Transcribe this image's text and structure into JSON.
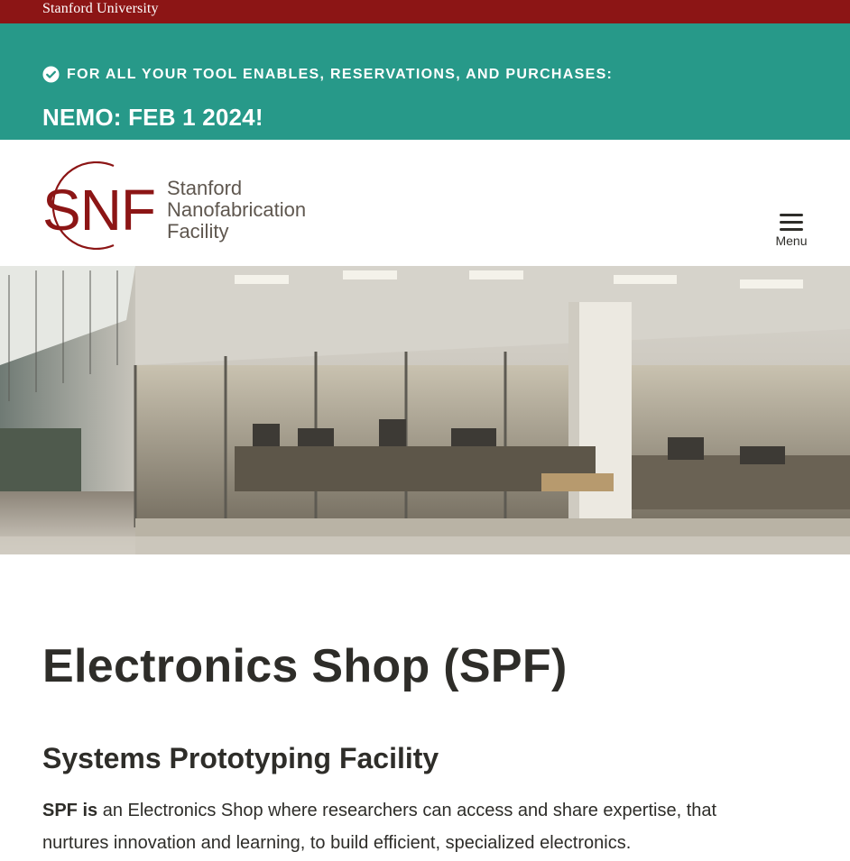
{
  "topbar": {
    "university": "Stanford University"
  },
  "alert": {
    "icon": "check-circle-icon",
    "label": "For all your tool enables, reservations, and purchases:",
    "headline": "NEMO: FEB 1 2024!",
    "background": "#279989"
  },
  "header": {
    "logo_letters": "SNF",
    "logo_line1": "Stanford",
    "logo_line2": "Nanofabrication",
    "logo_line3": "Facility",
    "menu_icon": "hamburger-icon",
    "menu_label": "Menu"
  },
  "hero": {
    "image": "lab-interior-photo"
  },
  "main": {
    "title": "Electronics Shop (SPF)",
    "subtitle": "Systems Prototyping Facility",
    "intro_bold": "SPF is",
    "intro_text": " an Electronics Shop where researchers can access and share expertise, that nurtures innovation and learning, to build efficient, specialized electronics."
  },
  "colors": {
    "cardinal": "#8c1515",
    "teal": "#279989",
    "text": "#2e2d29"
  }
}
